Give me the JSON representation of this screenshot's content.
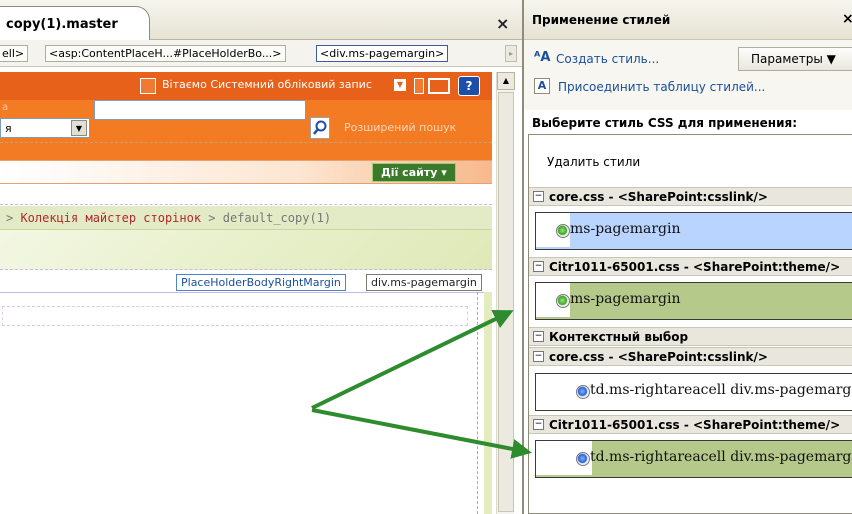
{
  "designer": {
    "tab_title": "copy(1).master",
    "close_glyph": "×",
    "tag_selector": {
      "items": [
        "ell>",
        "<asp:ContentPlaceH...#PlaceHolderBo...>",
        "<div.ms-pagemargin>"
      ],
      "scroll_glyph": "▸"
    },
    "sharepoint": {
      "welcome_text": "Вітаємо Системний обліковий запис",
      "help_glyph": "?",
      "site_label": "а",
      "scope_value": "я",
      "advanced_search": "Розширений пошук",
      "site_actions": "Дії сайту ▾",
      "breadcrumb_prefix": "> ",
      "breadcrumb_link": "Колекція майстер сторінок",
      "breadcrumb_suffix": " > default_copy(1)",
      "chip_placeholder": "PlaceHolderBodyRightMargin",
      "chip_div": "div.ms-pagemargin"
    }
  },
  "apply_styles": {
    "title": "Применение стилей",
    "close_glyph": "×",
    "new_style": "Создать стиль...",
    "options": "Параметры ▼",
    "attach_stylesheet": "Присоединить таблицу стилей...",
    "select_label": "Выберите стиль CSS для применения:",
    "clear_styles": "Удалить стили",
    "groups": [
      {
        "label": "core.css - <SharePoint:csslink/>"
      },
      {
        "label": "Citr1011-65001.css - <SharePoint:theme/>"
      },
      {
        "label": "Контекстный выбор"
      },
      {
        "label": "core.css - <SharePoint:csslink/>"
      },
      {
        "label": "Citr1011-65001.css - <SharePoint:theme/>"
      }
    ],
    "styles": [
      {
        "text": "ms-pagemargin"
      },
      {
        "text": "ms-pagemargin"
      },
      {
        "text": "td.ms-rightareacell div.ms-pagemargin"
      },
      {
        "text": "td.ms-rightareacell div.ms-pagemargin"
      }
    ],
    "toggle_glyph": "−",
    "colors": {
      "arrow": "#2e8b2e",
      "sharepoint_orange": "#e8611a",
      "highlight_blue": "#b9d5ff",
      "highlight_green": "#b5c98a"
    }
  }
}
